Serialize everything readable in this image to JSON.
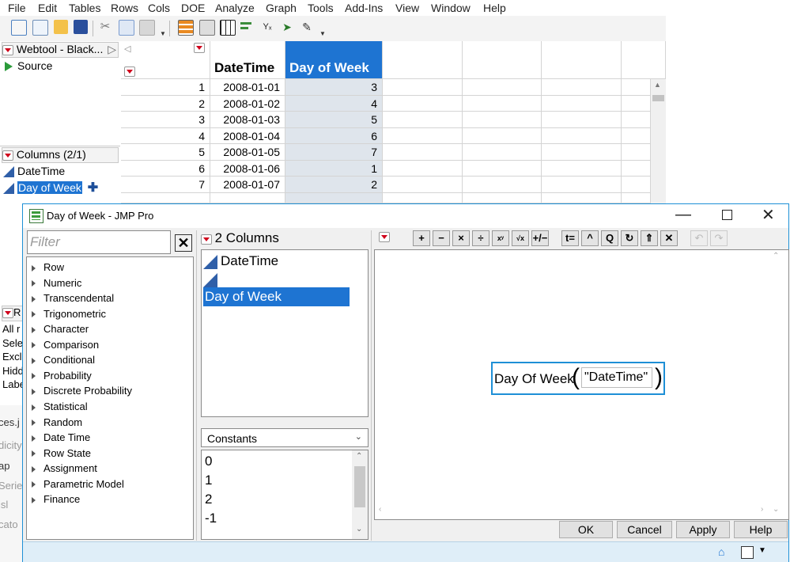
{
  "menu": [
    "File",
    "Edit",
    "Tables",
    "Rows",
    "Cols",
    "DOE",
    "Analyze",
    "Graph",
    "Tools",
    "Add-Ins",
    "View",
    "Window",
    "Help"
  ],
  "left_panel": {
    "table_name": "Webtool - Black...",
    "source": "Source",
    "columns_header": "Columns (2/1)",
    "columns": [
      "DateTime",
      "Day of Week"
    ],
    "partial_rows_header_items": [
      "All r",
      "Sele",
      "Excl",
      "Hidd",
      "Labe"
    ],
    "background_text": [
      "ces.j",
      "dicity",
      "ap",
      "Series",
      "jsl",
      "cato"
    ]
  },
  "grid": {
    "headers": [
      "DateTime",
      "Day of Week"
    ],
    "rows": [
      {
        "n": "1",
        "date": "2008-01-01",
        "dow": "3"
      },
      {
        "n": "2",
        "date": "2008-01-02",
        "dow": "4"
      },
      {
        "n": "3",
        "date": "2008-01-03",
        "dow": "5"
      },
      {
        "n": "4",
        "date": "2008-01-04",
        "dow": "6"
      },
      {
        "n": "5",
        "date": "2008-01-05",
        "dow": "7"
      },
      {
        "n": "6",
        "date": "2008-01-06",
        "dow": "1"
      },
      {
        "n": "7",
        "date": "2008-01-07",
        "dow": "2"
      }
    ]
  },
  "dialog": {
    "title": "Day of Week - JMP Pro",
    "filter_placeholder": "Filter",
    "functions": [
      "Row",
      "Numeric",
      "Transcendental",
      "Trigonometric",
      "Character",
      "Comparison",
      "Conditional",
      "Probability",
      "Discrete Probability",
      "Statistical",
      "Random",
      "Date Time",
      "Row State",
      "Assignment",
      "Parametric Model",
      "Finance"
    ],
    "columns_header": "2 Columns",
    "columns": [
      "DateTime",
      "Day of Week"
    ],
    "constants_label": "Constants",
    "constants": [
      "0",
      "1",
      "2",
      "-1"
    ],
    "formula_fn": "Day Of Week",
    "formula_arg": "\"DateTime\"",
    "buttons": {
      "ok": "OK",
      "cancel": "Cancel",
      "apply": "Apply",
      "help": "Help"
    },
    "editor_buttons": [
      "+",
      "−",
      "×",
      "÷",
      "xʸ",
      "√x",
      "+/−",
      "t=",
      "^",
      "Q",
      "↻",
      "⇑",
      "✕"
    ]
  },
  "colors": {
    "accent": "#0078d7",
    "selection": "#1e74d2",
    "column_icon": "#2f5fa8",
    "red_triangle": "#d0021b"
  }
}
